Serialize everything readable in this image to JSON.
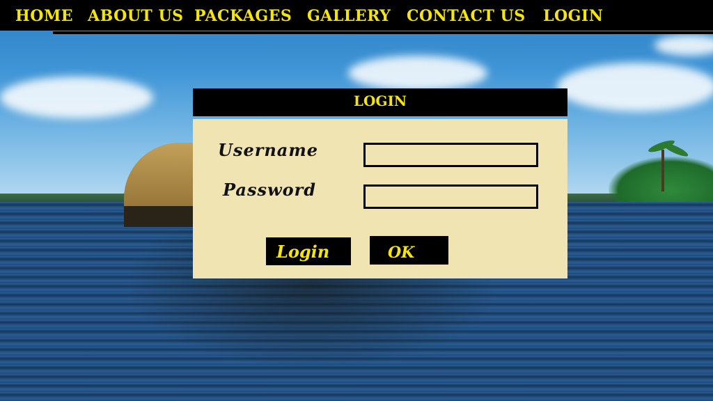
{
  "nav": {
    "home": "HOME",
    "about": "ABOUT US",
    "packages": "PACKAGES",
    "gallery": "GALLERY",
    "contact": "CONTACT US",
    "login": "LOGIN"
  },
  "login_panel": {
    "title": "LOGIN",
    "username_label": "Username",
    "password_label": "Password",
    "username_value": "",
    "password_value": "",
    "login_button": "Login",
    "ok_button": "OK"
  },
  "colors": {
    "accent_yellow": "#f5e40d",
    "panel_bg": "#efe4b2",
    "bar_bg": "#000000"
  }
}
